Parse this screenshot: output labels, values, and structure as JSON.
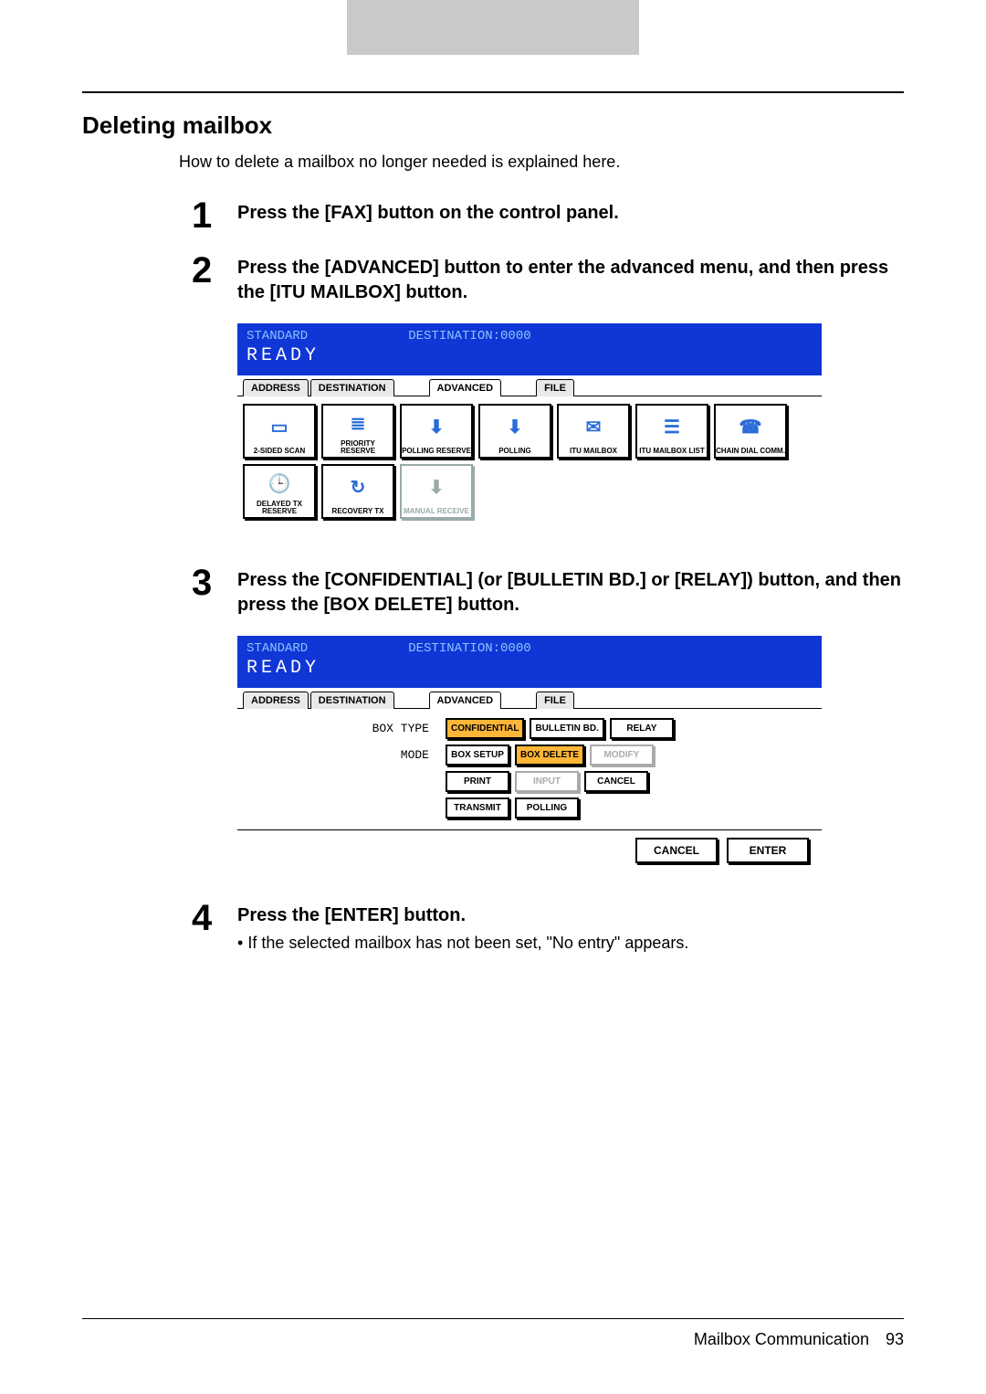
{
  "header_gray": "",
  "section_title": "Deleting mailbox",
  "intro": "How to delete a mailbox no longer needed is explained here.",
  "steps": {
    "s1": {
      "num": "1",
      "title": "Press the [FAX] button on the control panel."
    },
    "s2": {
      "num": "2",
      "title": "Press the [ADVANCED] button to enter the advanced menu, and then press the [ITU MAILBOX] button."
    },
    "s3": {
      "num": "3",
      "title": "Press the [CONFIDENTIAL] (or [BULLETIN BD.] or [RELAY]) button, and then press the [BOX DELETE] button."
    },
    "s4": {
      "num": "4",
      "title": "Press the [ENTER] button.",
      "bullet": "If the selected mailbox has not been set, \"No entry\" appears."
    }
  },
  "screen1": {
    "standard": "STANDARD",
    "destination": "DESTINATION:0000",
    "ready": "READY",
    "tabs": {
      "address": "ADDRESS",
      "destination_tab": "DESTINATION",
      "advanced": "ADVANCED",
      "file": "FILE"
    },
    "buttons": {
      "r1": {
        "b1": "2-SIDED SCAN",
        "b2": "PRIORITY RESERVE",
        "b3": "POLLING RESERVE",
        "b4": "POLLING",
        "b5": "ITU MAILBOX",
        "b6": "ITU MAILBOX LIST",
        "b7": "CHAIN DIAL COMM."
      },
      "r2": {
        "b1": "DELAYED TX RESERVE",
        "b2": "RECOVERY TX",
        "b3": "MANUAL RECEIVE"
      }
    }
  },
  "screen2": {
    "standard": "STANDARD",
    "destination": "DESTINATION:0000",
    "ready": "READY",
    "tabs": {
      "address": "ADDRESS",
      "destination_tab": "DESTINATION",
      "advanced": "ADVANCED",
      "file": "FILE"
    },
    "rows": {
      "box_type": {
        "label": "BOX TYPE",
        "b1": "CONFIDENTIAL",
        "b2": "BULLETIN BD.",
        "b3": "RELAY"
      },
      "mode": {
        "label": "MODE",
        "b1": "BOX SETUP",
        "b2": "BOX DELETE",
        "b3": "MODIFY"
      },
      "r3": {
        "b1": "PRINT",
        "b2": "INPUT",
        "b3": "CANCEL"
      },
      "r4": {
        "b1": "TRANSMIT",
        "b2": "POLLING"
      }
    },
    "footer": {
      "cancel": "CANCEL",
      "enter": "ENTER"
    }
  },
  "footer": {
    "chapter": "Mailbox Communication",
    "page": "93"
  }
}
